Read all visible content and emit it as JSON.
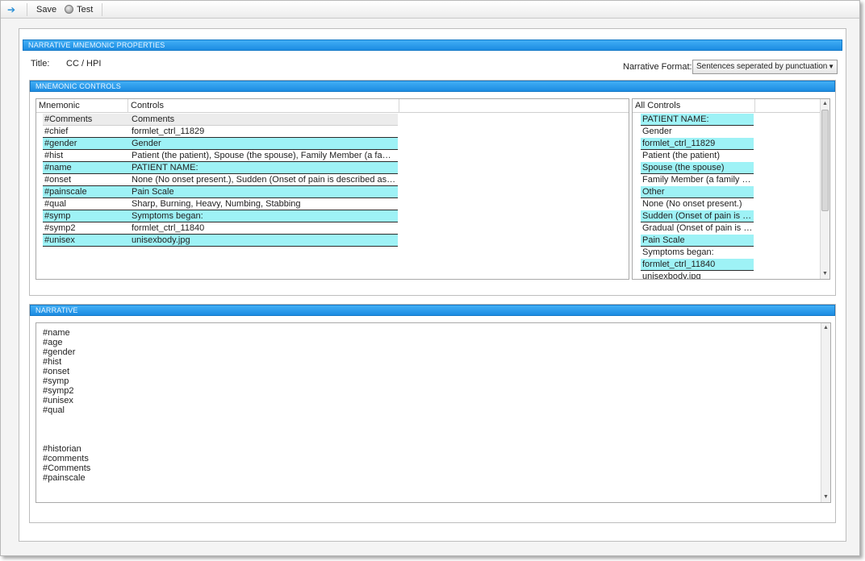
{
  "toolbar": {
    "save_label": "Save",
    "test_label": "Test"
  },
  "header_bar": {
    "label": "NARRATIVE MNEMONIC PROPERTIES"
  },
  "title": {
    "label": "Title:",
    "value": "CC / HPI"
  },
  "narrative_format": {
    "label": "Narrative Format:",
    "selected": "Sentences seperated by punctuation"
  },
  "mnemonics_bar": {
    "label": "MNEMONIC CONTROLS"
  },
  "mnemonic_grid": {
    "columns": [
      "Mnemonic",
      "Controls"
    ],
    "rows": [
      {
        "mnemonic": "#Comments",
        "controls": "Comments",
        "style": "hdr"
      },
      {
        "mnemonic": "#chief",
        "controls": "formlet_ctrl_11829",
        "style": ""
      },
      {
        "mnemonic": "#gender",
        "controls": "Gender",
        "style": "hl"
      },
      {
        "mnemonic": "#hist",
        "controls": "Patient (the patient), Spouse (the spouse), Family Member (a family mem...",
        "style": ""
      },
      {
        "mnemonic": "#name",
        "controls": "PATIENT NAME:",
        "style": "hl"
      },
      {
        "mnemonic": "#onset",
        "controls": "None (No onset present.), Sudden (Onset of pain is described as sudden)...",
        "style": ""
      },
      {
        "mnemonic": "#painscale",
        "controls": "Pain Scale",
        "style": "hl"
      },
      {
        "mnemonic": "#qual",
        "controls": "Sharp, Burning, Heavy, Numbing, Stabbing",
        "style": ""
      },
      {
        "mnemonic": "#symp",
        "controls": "Symptoms began:",
        "style": "hl"
      },
      {
        "mnemonic": "#symp2",
        "controls": "formlet_ctrl_11840",
        "style": ""
      },
      {
        "mnemonic": "#unisex",
        "controls": "unisexbody.jpg",
        "style": "hl"
      }
    ]
  },
  "all_controls": {
    "header": "All Controls",
    "items": [
      {
        "label": "PATIENT NAME:",
        "style": "hl"
      },
      {
        "label": "Gender",
        "style": ""
      },
      {
        "label": "formlet_ctrl_11829",
        "style": "hl"
      },
      {
        "label": "Patient (the patient)",
        "style": ""
      },
      {
        "label": "Spouse (the spouse)",
        "style": "hl"
      },
      {
        "label": "Family Member (a family me...",
        "style": ""
      },
      {
        "label": "Other",
        "style": "hl"
      },
      {
        "label": "None (No onset present.)",
        "style": ""
      },
      {
        "label": "Sudden (Onset of pain is des...",
        "style": "hl"
      },
      {
        "label": "Gradual (Onset of pain is des...",
        "style": ""
      },
      {
        "label": "Pain Scale",
        "style": "hl"
      },
      {
        "label": "Symptoms began:",
        "style": ""
      },
      {
        "label": "formlet_ctrl_11840",
        "style": "hl"
      },
      {
        "label": "unisexbody.jpg",
        "style": ""
      }
    ]
  },
  "narrative_bar": {
    "label": "NARRATIVE"
  },
  "narrative_text": "#name\n#age\n#gender\n#hist\n#onset\n#symp\n#symp2\n#unisex\n#qual\n\n\n\n#historian\n#comments\n#Comments\n#painscale",
  "colors": {
    "accent_bar": "#1c8ce2",
    "row_highlight": "#9ef2f6"
  }
}
